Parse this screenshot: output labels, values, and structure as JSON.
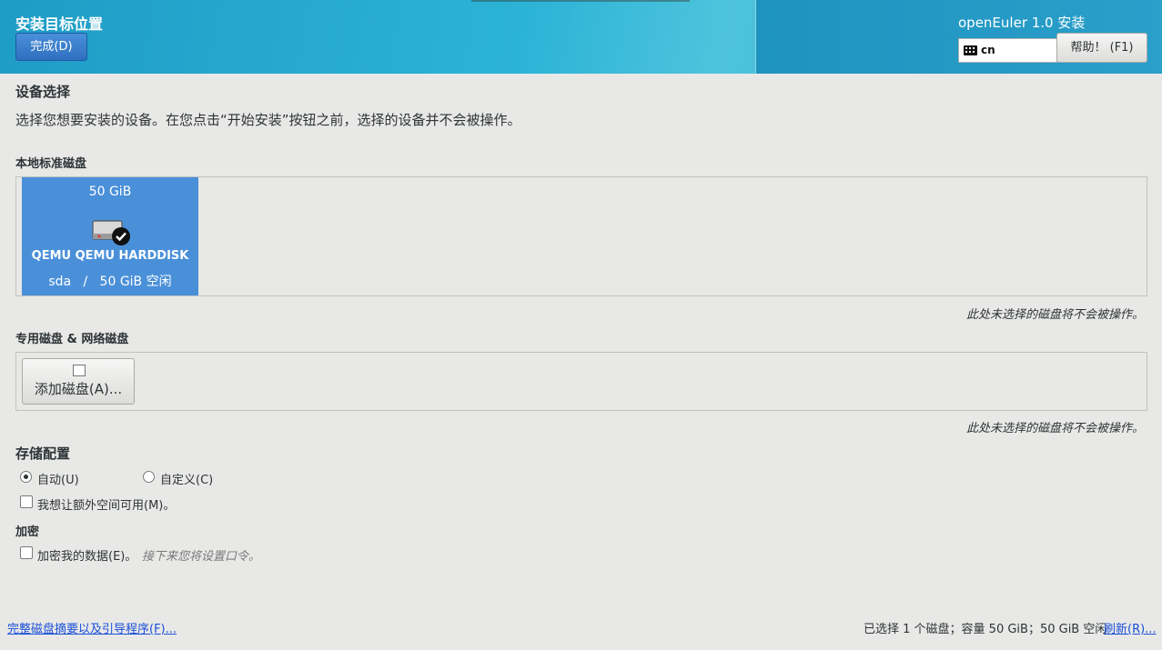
{
  "header": {
    "title": "安装目标位置",
    "done_label": "完成(D)",
    "product": "openEuler 1.0 安装",
    "keyboard_layout": "cn",
    "help_label": "帮助！ (F1)"
  },
  "device_selection": {
    "heading": "设备选择",
    "description": "选择您想要安装的设备。在您点击“开始安装”按钮之前，选择的设备并不会被操作。"
  },
  "local_disks": {
    "heading": "本地标准磁盘",
    "disks": [
      {
        "size": "50 GiB",
        "name": "QEMU QEMU HARDDISK",
        "info": "sda   /   50 GiB 空闲",
        "selected": true
      }
    ],
    "note": "此处未选择的磁盘将不会被操作。"
  },
  "special_disks": {
    "heading": "专用磁盘 & 网络磁盘",
    "add_label": "添加磁盘(A)...",
    "note": "此处未选择的磁盘将不会被操作。"
  },
  "storage_config": {
    "heading": "存储配置",
    "auto_label": "自动(U)",
    "custom_label": "自定义(C)",
    "selected": "auto",
    "extra_space_label": "我想让额外空间可用(M)。"
  },
  "encryption": {
    "heading": "加密",
    "encrypt_label": "加密我的数据(E)。",
    "hint": "接下来您将设置口令。"
  },
  "footer": {
    "summary_link": "完整磁盘摘要以及引导程序(F)...",
    "status": "已选择 1 个磁盘；容量 50 GiB；50 GiB 空闲",
    "refresh_link": "刷新(R)..."
  },
  "colors": {
    "accent": "#4a90d9",
    "header": "#2bb3d6",
    "link": "#1a4fd8"
  }
}
